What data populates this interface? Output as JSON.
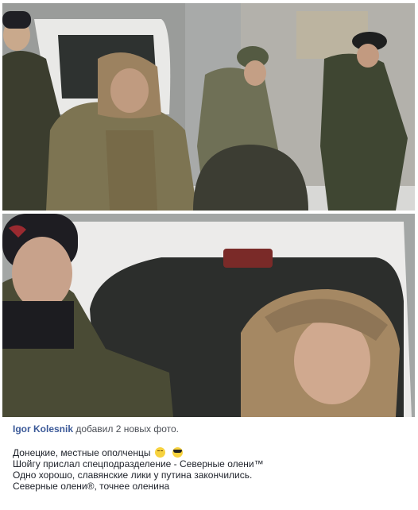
{
  "post": {
    "author": "Igor Kolesnik",
    "action": "добавил 2 новых фото.",
    "lines": [
      "Донецкие, местные ополченцы",
      "Шойгу прислал спецподразделение - Северные олени™",
      "Одно хорошо, славянские лики у путина закончились.",
      "Северные олени®, точнее оленина"
    ],
    "emojis": [
      "unamused-face-icon",
      "sunglasses-face-icon"
    ]
  },
  "colors": {
    "author_link": "#3b5998",
    "text": "#1d2129",
    "meta_text": "#4b4f56"
  }
}
